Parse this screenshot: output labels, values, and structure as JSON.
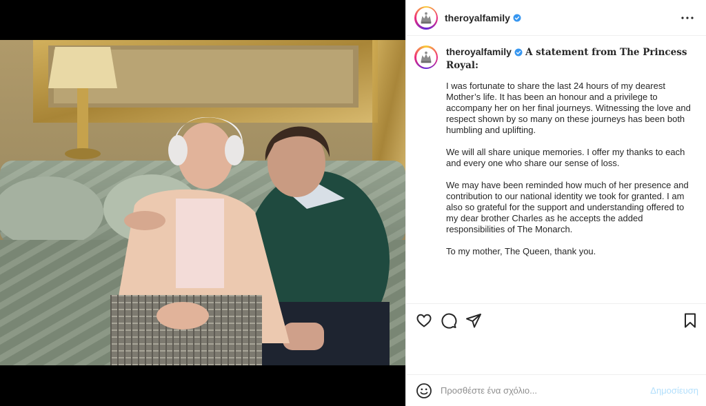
{
  "post": {
    "username": "theroyalfamily",
    "caption_username": "theroyalfamily",
    "caption_title": "A statement from The Princess Royal:",
    "paragraphs": [
      "I was fortunate to share the last 24 hours of my dearest Mother’s life. It has been an honour and a privilege to accompany her on her final journeys. Witnessing the love and respect shown by so many on these journeys has been both humbling and uplifting.",
      "We will all share unique memories. I offer my thanks to each and every one who share our sense of loss.",
      "We may have been reminded how much of her presence and contribution to our national identity we took for granted. I am also so grateful for the support and understanding offered to my dear brother Charles as he accepts the added responsibilities of The Monarch.",
      "To my mother, The Queen, thank you."
    ]
  },
  "comment": {
    "placeholder": "Προσθέστε ένα σχόλιο...",
    "post_label": "Δημοσίευση"
  },
  "icons": {
    "more": "more-options-icon",
    "like": "heart-icon",
    "comment": "comment-icon",
    "share": "share-icon",
    "save": "bookmark-icon",
    "emoji": "emoji-icon",
    "verified": "verified-badge-icon"
  },
  "colors": {
    "verified": "#3897f0",
    "post_button": "#b2dffc",
    "placeholder": "#8e8e8e",
    "divider": "#efefef"
  }
}
